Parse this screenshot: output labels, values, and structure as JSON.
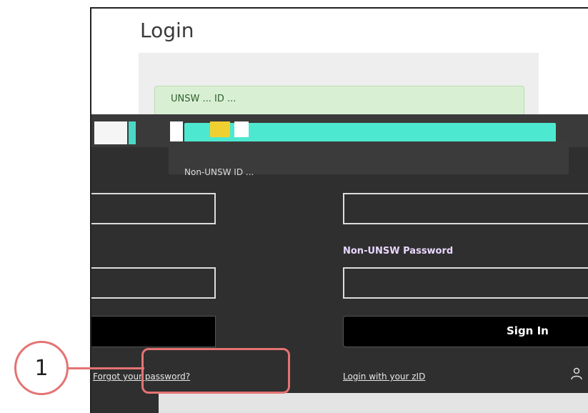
{
  "page": {
    "title": "Login",
    "notice_text": "UNSW ... ID ...",
    "mid_text": "Non-UNSW ID ...",
    "password_label": "Non-UNSW Password",
    "sign_in_label": "Sign In",
    "forgot_link": "Forgot your password?",
    "alt_login_link": "Login with your zID"
  },
  "callout": {
    "number": "1"
  },
  "colors": {
    "accent": "#4de8d0",
    "highlight": "#e57373",
    "dark_bg": "#2f2f2f"
  }
}
